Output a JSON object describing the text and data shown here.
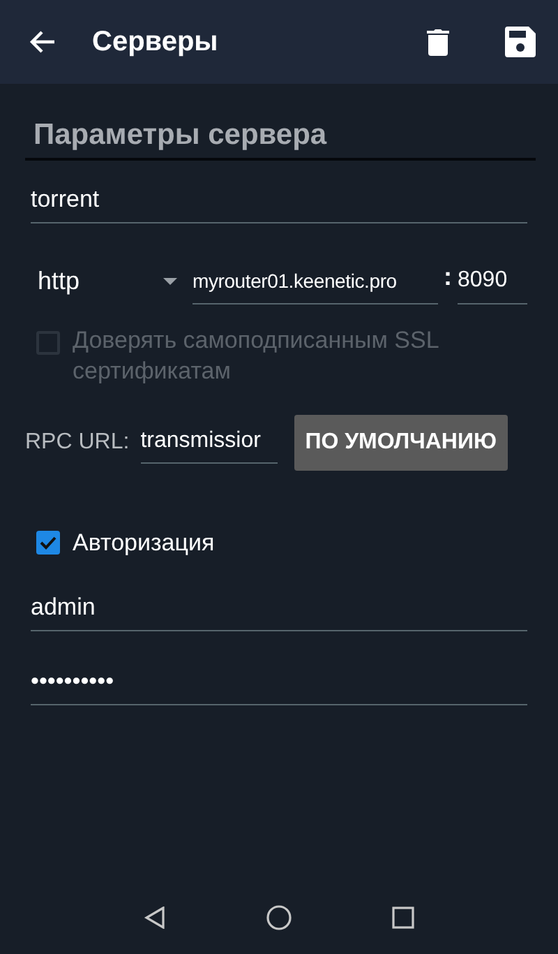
{
  "app_bar": {
    "title": "Серверы"
  },
  "section_title": "Параметры сервера",
  "name_field": {
    "value": "torrent"
  },
  "protocol": {
    "value": "http"
  },
  "host_field": {
    "value": "myrouter01.keenetic.pro"
  },
  "port_separator": ":",
  "port_field": {
    "value": "8090"
  },
  "trust_ssl": {
    "label": "Доверять самоподписанным SSL сертификатам",
    "checked": false,
    "disabled": true
  },
  "rpc_url": {
    "label": "RPC URL:",
    "value": "transmissior",
    "default_button": "ПО УМОЛЧАНИЮ"
  },
  "authorization": {
    "label": "Авторизация",
    "checked": true,
    "disabled": false
  },
  "username_field": {
    "value": "admin"
  },
  "password_field": {
    "value": "••••••••••"
  }
}
